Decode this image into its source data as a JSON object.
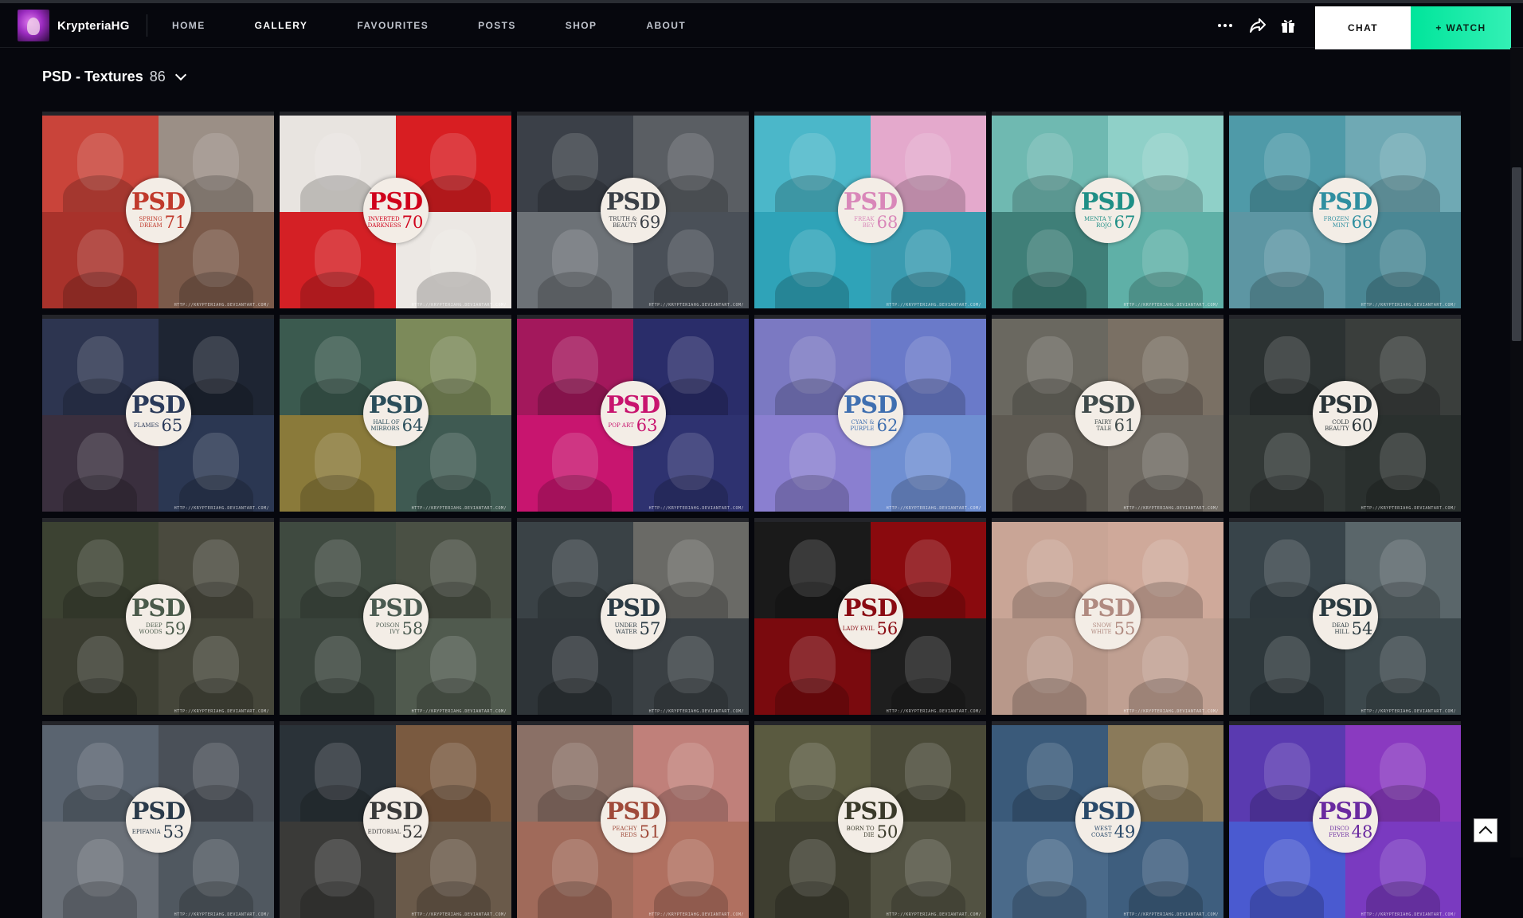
{
  "profile": {
    "username": "KrypteriaHG"
  },
  "nav": {
    "items": [
      {
        "label": "HOME",
        "active": false
      },
      {
        "label": "GALLERY",
        "active": true
      },
      {
        "label": "FAVOURITES",
        "active": false
      },
      {
        "label": "POSTS",
        "active": false
      },
      {
        "label": "SHOP",
        "active": false
      },
      {
        "label": "ABOUT",
        "active": false
      }
    ]
  },
  "toolbar": {
    "more_icon": "more-dots-icon",
    "share_icon": "share-arrow-icon",
    "gift_icon": "gift-icon",
    "chat_label": "CHAT",
    "watch_label": "+ WATCH",
    "watch_color": "#00e59b"
  },
  "gallery": {
    "title": "PSD - Textures",
    "count": "86",
    "badge_label": "PSD",
    "credit": "HTTP://KRYPTERIAHG.DEVIANTART.COM/",
    "items": [
      {
        "name": "SPRING DREAM",
        "number": "71",
        "accent": "#c0392b",
        "quads": [
          "#c9443a",
          "#9b8f86",
          "#a8322b",
          "#7b5a4a"
        ]
      },
      {
        "name": "INVERTED DARKNESS",
        "number": "70",
        "accent": "#d0021b",
        "quads": [
          "#e8e4e0",
          "#d81e22",
          "#d42025",
          "#ece8e4"
        ]
      },
      {
        "name": "TRUTH & BEAUTY",
        "number": "69",
        "accent": "#3a3f46",
        "quads": [
          "#3b4048",
          "#5a5e63",
          "#6d7277",
          "#4a5058"
        ]
      },
      {
        "name": "FREAK BEY",
        "number": "68",
        "accent": "#d987b9",
        "quads": [
          "#4bb7c9",
          "#e4a9cc",
          "#2fa3b8",
          "#3a9bb0"
        ]
      },
      {
        "name": "MENTA Y ROJO",
        "number": "67",
        "accent": "#1f8f86",
        "quads": [
          "#6fb9b1",
          "#8fd0c8",
          "#3f7f78",
          "#5fb0a7"
        ]
      },
      {
        "name": "FROZEN MINT",
        "number": "66",
        "accent": "#2f8fa0",
        "quads": [
          "#4f9aa8",
          "#6fa9b4",
          "#5d96a3",
          "#4a8794"
        ]
      },
      {
        "name": "FLAMES",
        "number": "65",
        "accent": "#2a3a5a",
        "quads": [
          "#2d3550",
          "#1e2533",
          "#3a2f3e",
          "#2b3752"
        ]
      },
      {
        "name": "HALL OF MIRRORS",
        "number": "64",
        "accent": "#2a4d5a",
        "quads": [
          "#3b5a4f",
          "#7c8a5a",
          "#8a7a3a",
          "#3f5a52"
        ]
      },
      {
        "name": "POP ART",
        "number": "63",
        "accent": "#c8146e",
        "quads": [
          "#a3185c",
          "#2a2d6a",
          "#c8156f",
          "#2e3270"
        ]
      },
      {
        "name": "CYAN & PURPLE",
        "number": "62",
        "accent": "#3f6fb0",
        "quads": [
          "#7b79c2",
          "#6a7ac9",
          "#8a7fd0",
          "#6f8fd2"
        ]
      },
      {
        "name": "FAIRY TALE",
        "number": "61",
        "accent": "#3f4a4a",
        "quads": [
          "#6a6860",
          "#7a7064",
          "#5e5a52",
          "#6f6a62"
        ]
      },
      {
        "name": "COLD BEAUTY",
        "number": "60",
        "accent": "#2a3438",
        "quads": [
          "#2c3232",
          "#3a3e3c",
          "#323836",
          "#2a302e"
        ]
      },
      {
        "name": "DEEP WOODS",
        "number": "59",
        "accent": "#4a5a4a",
        "quads": [
          "#3c4232",
          "#4a4a3e",
          "#3a3c30",
          "#45463a"
        ]
      },
      {
        "name": "POISON IVY",
        "number": "58",
        "accent": "#4a5a50",
        "quads": [
          "#3f4a40",
          "#4a5044",
          "#3a443c",
          "#505a4e"
        ]
      },
      {
        "name": "UNDER WATER",
        "number": "57",
        "accent": "#2a3a44",
        "quads": [
          "#3a4246",
          "#6a6a66",
          "#2e3438",
          "#3a4044"
        ]
      },
      {
        "name": "LADY EVIL",
        "number": "56",
        "accent": "#8a0a12",
        "quads": [
          "#1a1a1a",
          "#8a0a0e",
          "#7a0a0e",
          "#1e1e1e"
        ]
      },
      {
        "name": "SNOW WHITE",
        "number": "55",
        "accent": "#b08a80",
        "quads": [
          "#c9a596",
          "#cfa99a",
          "#b8988a",
          "#c0a092"
        ]
      },
      {
        "name": "DEAD HILL",
        "number": "54",
        "accent": "#2a3a40",
        "quads": [
          "#38444a",
          "#5a666a",
          "#2e383c",
          "#3c484c"
        ]
      },
      {
        "name": "EPIFANÍA",
        "number": "53",
        "accent": "#2a3a4a",
        "quads": [
          "#5a6470",
          "#4a5058",
          "#6a7078",
          "#505860"
        ]
      },
      {
        "name": "EDITORIAL",
        "number": "52",
        "accent": "#3a3a3a",
        "quads": [
          "#2a3238",
          "#7a5a40",
          "#3a3a38",
          "#6a5a4a"
        ]
      },
      {
        "name": "PEACHY REDS",
        "number": "51",
        "accent": "#a04a3a",
        "quads": [
          "#8a7066",
          "#c0807a",
          "#a06a5a",
          "#b07060"
        ]
      },
      {
        "name": "BORN TO DIE",
        "number": "50",
        "accent": "#3a3a2a",
        "quads": [
          "#5a5a40",
          "#4a4a38",
          "#3e3e30",
          "#525242"
        ]
      },
      {
        "name": "WEST COAST",
        "number": "49",
        "accent": "#2a4a6a",
        "quads": [
          "#3a5a7a",
          "#8a7a5a",
          "#4a6a8a",
          "#3e5e7e"
        ]
      },
      {
        "name": "DISCO FEVER",
        "number": "48",
        "accent": "#6a2aa0",
        "quads": [
          "#5a3ab0",
          "#8a3ac0",
          "#4a5ad0",
          "#7a3ac0"
        ]
      }
    ]
  }
}
